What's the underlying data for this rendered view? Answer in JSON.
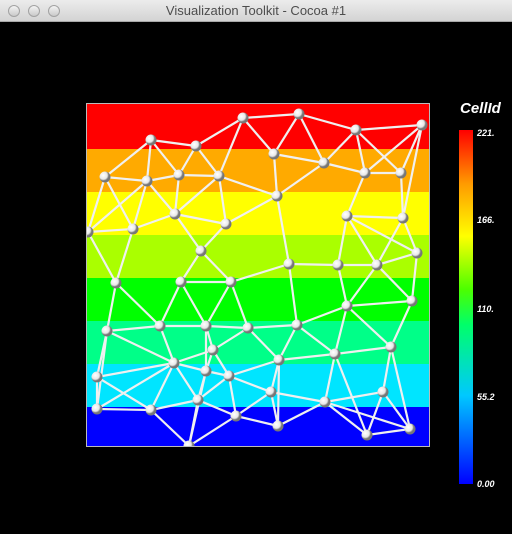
{
  "window": {
    "title": "Visualization Toolkit - Cocoa #1"
  },
  "scalar_bar": {
    "title": "CellId",
    "labels": [
      "221.",
      "166.",
      "110.",
      "55.2",
      "0.00"
    ],
    "gradient_colors": [
      "#0000ff",
      "#00c8ff",
      "#00ff6a",
      "#4cff00",
      "#ffff00",
      "#ff9900",
      "#ff0000"
    ]
  },
  "mesh": {
    "band_colors": [
      "#0000ff",
      "#00e5ff",
      "#00ff88",
      "#00ff00",
      "#aaff00",
      "#ffff00",
      "#ffaa00",
      "#ff0000"
    ],
    "node_color": "#e8e8e8",
    "edge_color": "#f0f0f0"
  }
}
